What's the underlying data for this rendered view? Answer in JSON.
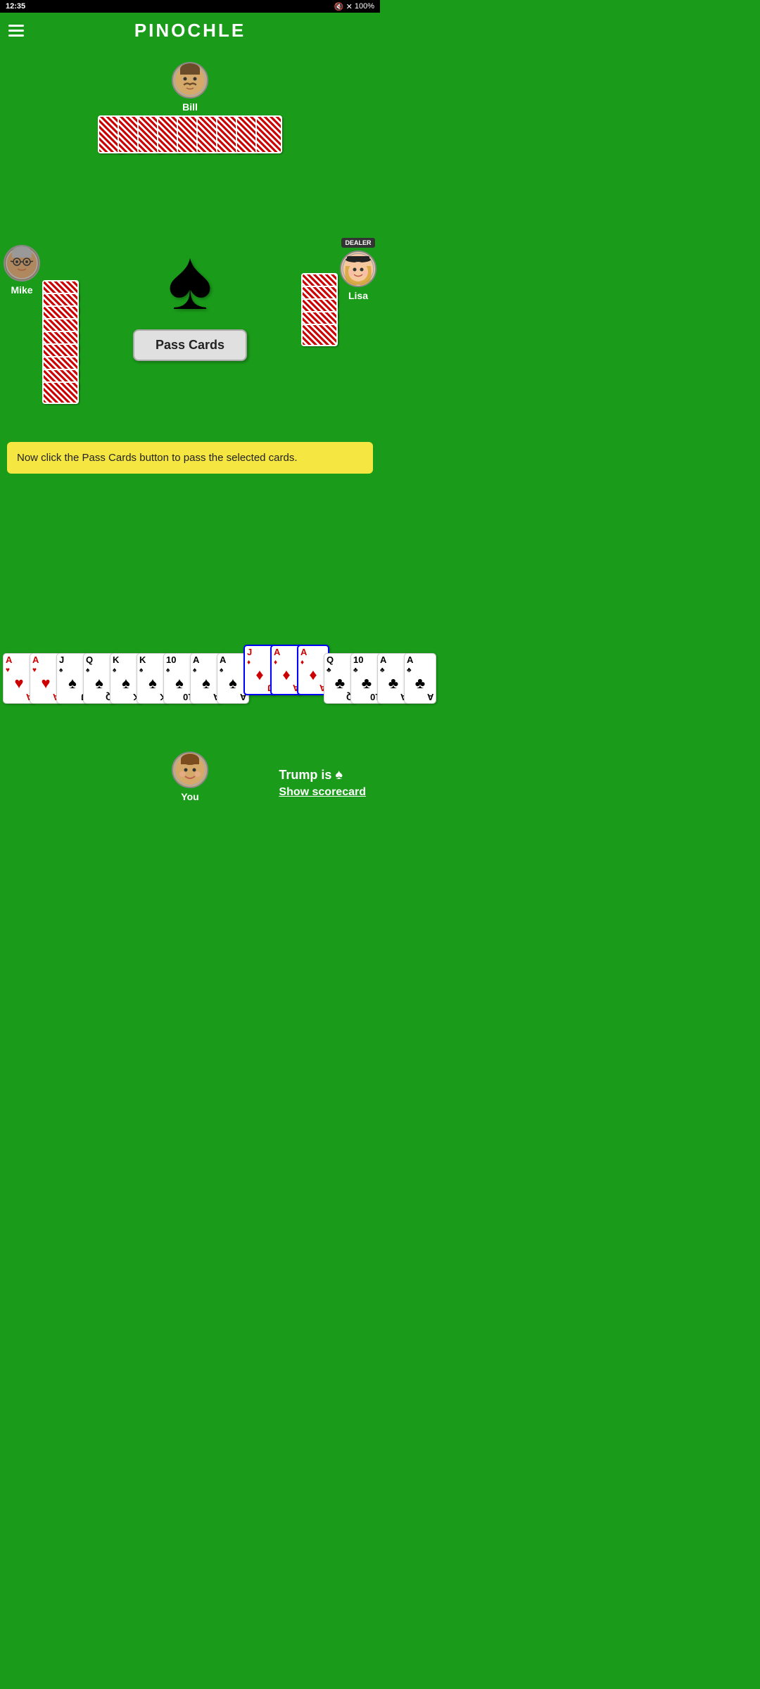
{
  "status_bar": {
    "time": "12:35",
    "battery": "100%"
  },
  "header": {
    "title": "PINOCHLE",
    "menu_label": "Menu"
  },
  "players": {
    "bill": {
      "name": "Bill",
      "avatar": "🧔"
    },
    "mike": {
      "name": "Mike",
      "avatar": "👴"
    },
    "lisa": {
      "name": "Lisa",
      "avatar": "👩",
      "is_dealer": true,
      "dealer_label": "DEALER"
    },
    "you": {
      "name": "You",
      "avatar": "🙂"
    }
  },
  "game": {
    "trump_suit": "♠",
    "trump_label": "Trump is",
    "pass_cards_button": "Pass Cards",
    "show_scorecard": "Show scorecard",
    "instruction": "Now click the Pass Cards button to pass the selected cards.",
    "spade_symbol": "♠"
  },
  "hand_cards": [
    {
      "rank": "A",
      "suit": "♥",
      "color": "red",
      "selected": false
    },
    {
      "rank": "A",
      "suit": "♥",
      "color": "red",
      "selected": false
    },
    {
      "rank": "J",
      "suit": "♠",
      "color": "black",
      "selected": false
    },
    {
      "rank": "Q",
      "suit": "♠",
      "color": "black",
      "selected": false
    },
    {
      "rank": "K",
      "suit": "♠",
      "color": "black",
      "selected": false
    },
    {
      "rank": "K",
      "suit": "♠",
      "color": "black",
      "selected": false
    },
    {
      "rank": "10",
      "suit": "♠",
      "color": "black",
      "selected": false
    },
    {
      "rank": "A",
      "suit": "♠",
      "color": "black",
      "selected": false
    },
    {
      "rank": "A",
      "suit": "♠",
      "color": "black",
      "selected": false
    },
    {
      "rank": "J",
      "suit": "♦",
      "color": "red",
      "selected": true
    },
    {
      "rank": "A",
      "suit": "♦",
      "color": "red",
      "selected": true
    },
    {
      "rank": "A",
      "suit": "♦",
      "color": "red",
      "selected": true
    },
    {
      "rank": "Q",
      "suit": "♣",
      "color": "black",
      "selected": false
    },
    {
      "rank": "10",
      "suit": "♣",
      "color": "black",
      "selected": false
    },
    {
      "rank": "A",
      "suit": "♣",
      "color": "black",
      "selected": false
    },
    {
      "rank": "A",
      "suit": "♣",
      "color": "black",
      "selected": false
    }
  ],
  "bill_card_count": 9,
  "mike_card_count": 9,
  "lisa_card_count": 5
}
